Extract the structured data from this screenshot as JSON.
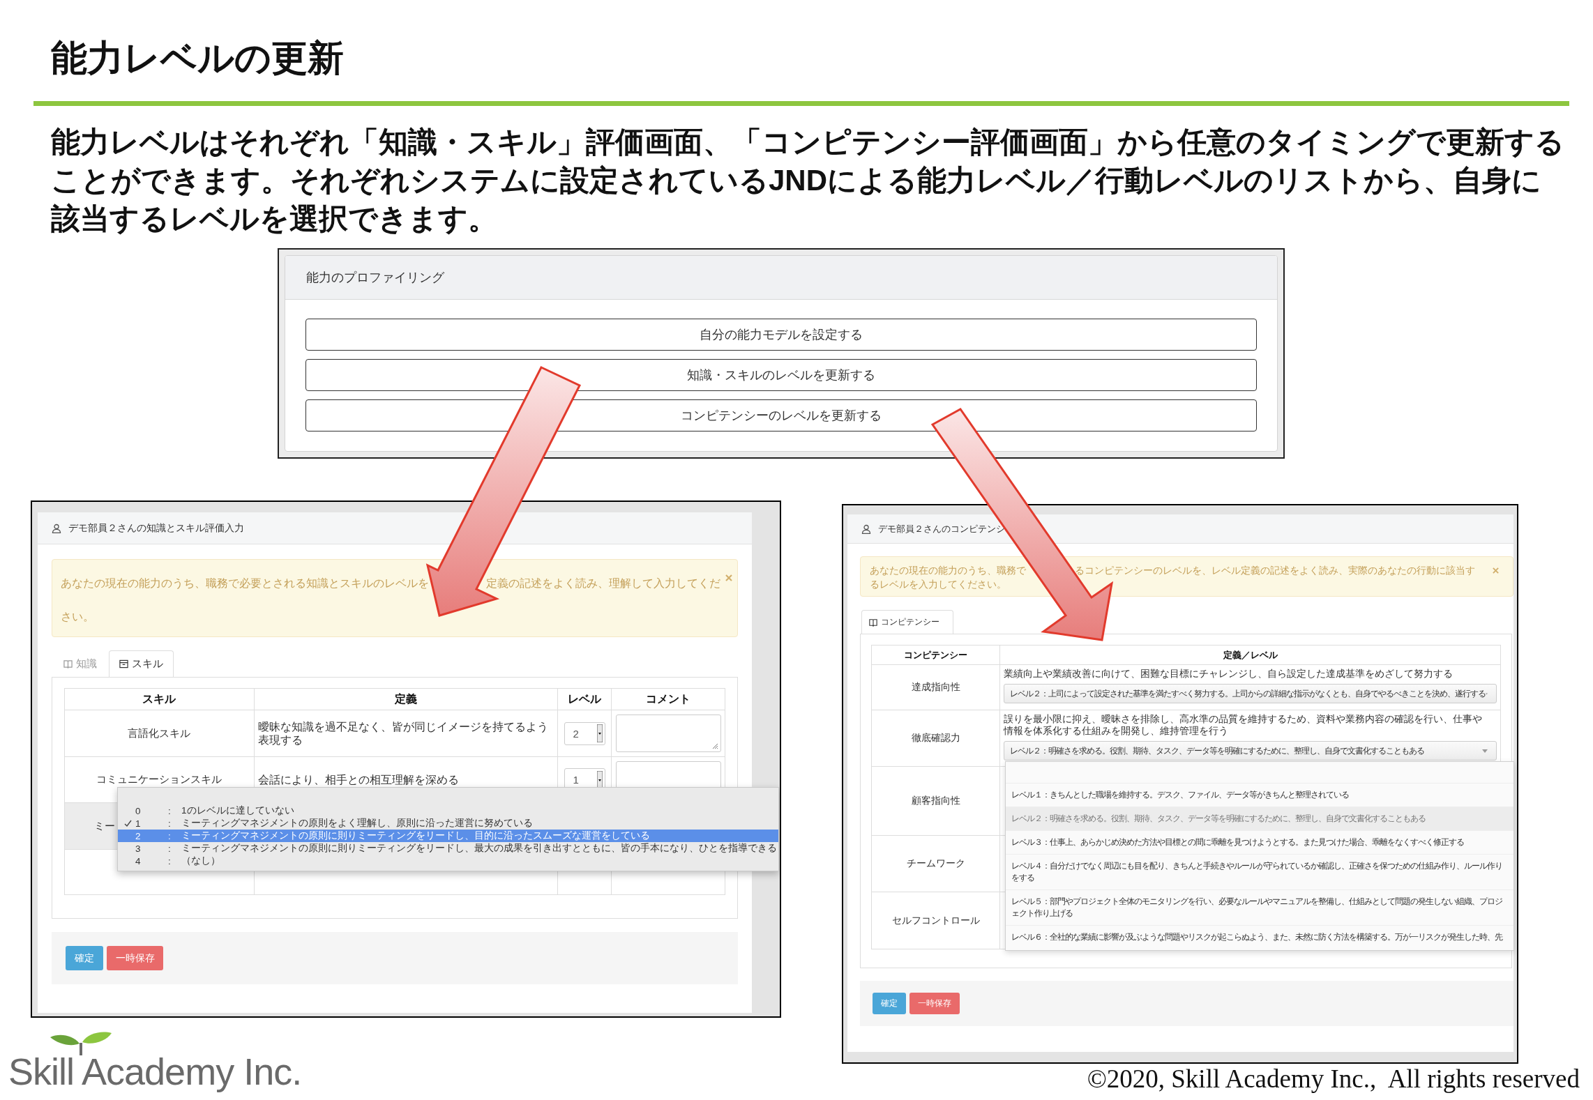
{
  "title": "能力レベルの更新",
  "description": "能力レベルはそれぞれ「知識・スキル」評価画面、「コンピテンシー評価画面」から任意のタイミングで更新することができます。それぞれシステムに設定されているJNDによる能力レベル／行動レベルのリストから、自身に該当するレベルを選択できます。",
  "profiling_panel": {
    "title": "能力のプロファイリング",
    "buttons": [
      "自分の能力モデルを設定する",
      "知識・スキルのレベルを更新する",
      "コンピテンシーのレベルを更新する"
    ]
  },
  "skill_window": {
    "title": "デモ部員２さんの知識とスキル評価入力",
    "alert": [
      "あなたの現在の能力のうち、職務で必要とされる知識とスキルのレベルを",
      "定義の記述をよく読み、理解して入力してくだ",
      "さい。"
    ],
    "tabs": [
      {
        "label": "知識",
        "selected": false
      },
      {
        "label": "スキル",
        "selected": true
      }
    ],
    "table": {
      "columns": [
        "スキル",
        "定義",
        "レベル",
        "コメント"
      ],
      "rows": [
        {
          "skill": "言語化スキル",
          "definition": "曖昧な知識を過不足なく、皆が同じイメージを持てるよう表現する",
          "level": "2",
          "selected": false
        },
        {
          "skill": "コミュニケーションスキル",
          "definition": "会話により、相手との相互理解を深める",
          "level": "1",
          "selected": false
        },
        {
          "skill": "ミー",
          "selected": true
        },
        {
          "selected": false
        }
      ]
    },
    "level_menu": {
      "options": [
        {
          "number": "0",
          "separator": ":",
          "text": "1のレベルに達していない",
          "checked": false,
          "highlighted": false
        },
        {
          "number": "1",
          "separator": ":",
          "text": "ミーティングマネジメントの原則をよく理解し、原則に沿った運営に努めている",
          "checked": true,
          "highlighted": false
        },
        {
          "number": "2",
          "separator": ":",
          "text": "ミーティングマネジメントの原則に則りミーティングをリードし、目的に沿ったスムーズな運営をしている",
          "checked": false,
          "highlighted": true
        },
        {
          "number": "3",
          "separator": ":",
          "text": "ミーティングマネジメントの原則に則りミーティングをリードし、最大の成果を引き出すとともに、皆の手本になり、ひとを指導できる",
          "checked": false,
          "highlighted": false
        },
        {
          "number": "4",
          "separator": ":",
          "text": "（なし）",
          "checked": false,
          "highlighted": false
        }
      ]
    },
    "buttons": [
      {
        "label": "確定",
        "kind": "confirm"
      },
      {
        "label": "一時保存",
        "kind": "save"
      }
    ]
  },
  "competency_window": {
    "title": "デモ部員２さんのコンピテンシ",
    "alert": [
      "あなたの現在の能力のうち、職務で",
      "るコンピテンシーのレベルを、レベル定義の記述をよく読み、実際のあなたの行動に該当す",
      "るレベルを入力してください。"
    ],
    "tabs": [
      {
        "label": "コンピテンシー",
        "selected": true
      }
    ],
    "table": {
      "columns": [
        "コンピテンシー",
        "定義／レベル"
      ],
      "rows": [
        {
          "name": "達成指向性",
          "definition": "業績向上や業績改善に向けて、困難な目標にチャレンジし、自ら設定した達成基準をめざして努力する",
          "level": "レベル２：上司によって設定された基準を満たすべく努力する。上司からの詳細な指示がなくとも、自身でやるべきことを決め、遂行する"
        },
        {
          "name": "徹底確認力",
          "definition": "誤りを最小限に抑え、曖昧さを排除し、高水準の品質を維持するため、資料や業務内容の確認を行い、仕事や情報を体系化する仕組みを開発し、維持管理を行う",
          "level": "レベル２：明確さを求める。役割、期待、タスク、データ等を明確にするために、整理し、自身で文書化することもある"
        },
        {
          "name": "顧客指向性"
        },
        {
          "name": "チームワーク"
        },
        {
          "name": "セルフコントロール"
        }
      ]
    },
    "level_list": {
      "options": [
        {
          "text": "レベル１：きちんとした職場を維持する。デスク、ファイル、データ等がきちんと整理されている",
          "selected": false
        },
        {
          "text": "レベル２：明確さを求める。役割、期待、タスク、データ等を明確にするために、整理し、自身で文書化することもある",
          "selected": true
        },
        {
          "text": "レベル３：仕事上、あらかじめ決めた方法や目標との間に乖離を見つけようとする。また見つけた場合、乖離をなくすべく修正する",
          "selected": false
        },
        {
          "text": "レベル４：自分だけでなく周辺にも目を配り、きちんと手続きやルールが守られているか確認し、正確さを保つための仕組み作り、ルール作りをする",
          "selected": false
        },
        {
          "text": "レベル５：部門やプロジェクト全体のモニタリングを行い、必要なルールやマニュアルを整備し、仕組みとして問題の発生しない組織、プロジェクト作り上げる",
          "selected": false
        },
        {
          "text": "レベル６：全社的な業績に影響が及ぶような問題やリスクが起こらぬよう、また、未然に防く方法を構築する。万が一リスクが発生した時、先",
          "selected": false
        }
      ]
    },
    "buttons": [
      {
        "label": "確定",
        "kind": "confirm"
      },
      {
        "label": "一時保存",
        "kind": "save"
      }
    ]
  },
  "footer": {
    "logo": "Skill Academy Inc.",
    "copyright": "©2020, Skill Academy Inc.,  All rights reserved"
  }
}
